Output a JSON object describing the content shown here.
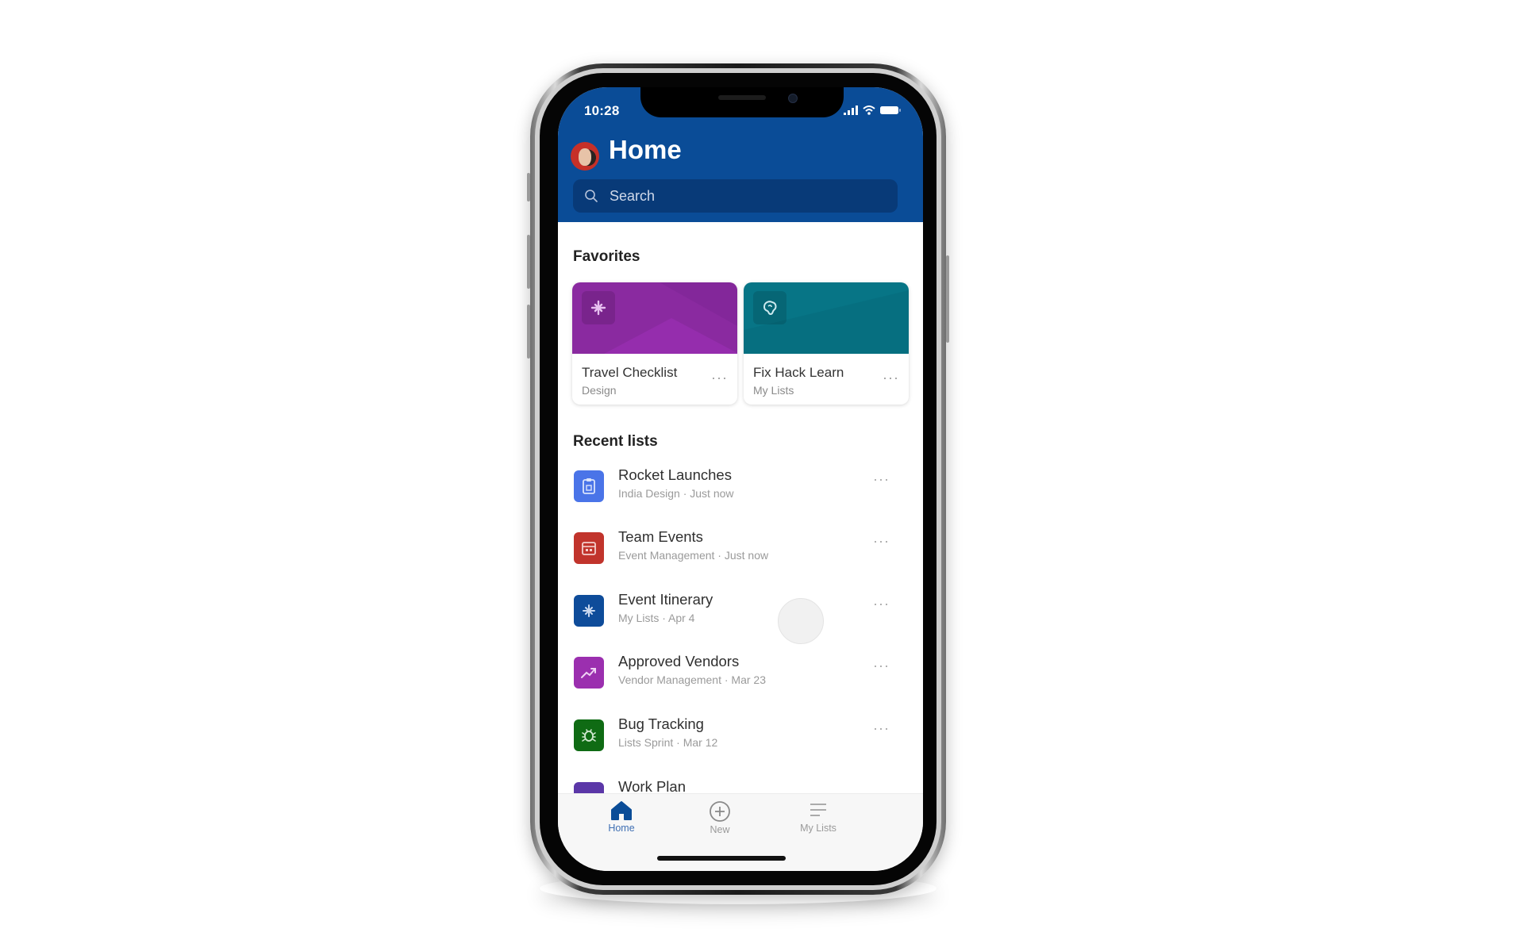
{
  "status_bar": {
    "time": "10:28",
    "icons": [
      "signal-icon",
      "wifi-icon",
      "battery-icon"
    ]
  },
  "header": {
    "title": "Home",
    "avatar": "user-avatar"
  },
  "search": {
    "placeholder": "Search"
  },
  "favorites": {
    "heading": "Favorites",
    "items": [
      {
        "title": "Travel Checklist",
        "subtitle": "Design",
        "icon": "airplane-icon",
        "color": "#8A2AA0",
        "more_label": "···"
      },
      {
        "title": "Fix Hack Learn",
        "subtitle": "My Lists",
        "icon": "brain-icon",
        "color": "#077586",
        "more_label": "···"
      }
    ]
  },
  "recent": {
    "heading": "Recent lists",
    "items": [
      {
        "title": "Rocket Launches",
        "subtitle": "India Design · Just now",
        "icon": "clipboard-icon",
        "color": "#4A74E8",
        "more_label": "···"
      },
      {
        "title": "Team Events",
        "subtitle": "Event Management · Just now",
        "icon": "calendar-icon",
        "color": "#C1342C",
        "more_label": "···"
      },
      {
        "title": "Event Itinerary",
        "subtitle": "My Lists · Apr 4",
        "icon": "airplane-icon",
        "color": "#0E4C9A",
        "more_label": "···"
      },
      {
        "title": "Approved Vendors",
        "subtitle": "Vendor Management · Mar 23",
        "icon": "trending-up-icon",
        "color": "#9B2FAF",
        "more_label": "···"
      },
      {
        "title": "Bug Tracking",
        "subtitle": "Lists Sprint · Mar 12",
        "icon": "bug-icon",
        "color": "#0F6B14",
        "more_label": "···"
      },
      {
        "title": "Work Plan",
        "subtitle": "",
        "icon": "list-icon",
        "color": "#5B37A8",
        "more_label": ""
      }
    ]
  },
  "bottom_nav": {
    "items": [
      {
        "label": "Home",
        "icon": "home-icon",
        "active": true
      },
      {
        "label": "New",
        "icon": "plus-circle-icon",
        "active": false
      },
      {
        "label": "My Lists",
        "icon": "lines-icon",
        "active": false
      }
    ],
    "active_color": "#0A4C97",
    "inactive_color": "#9a9a9a"
  }
}
